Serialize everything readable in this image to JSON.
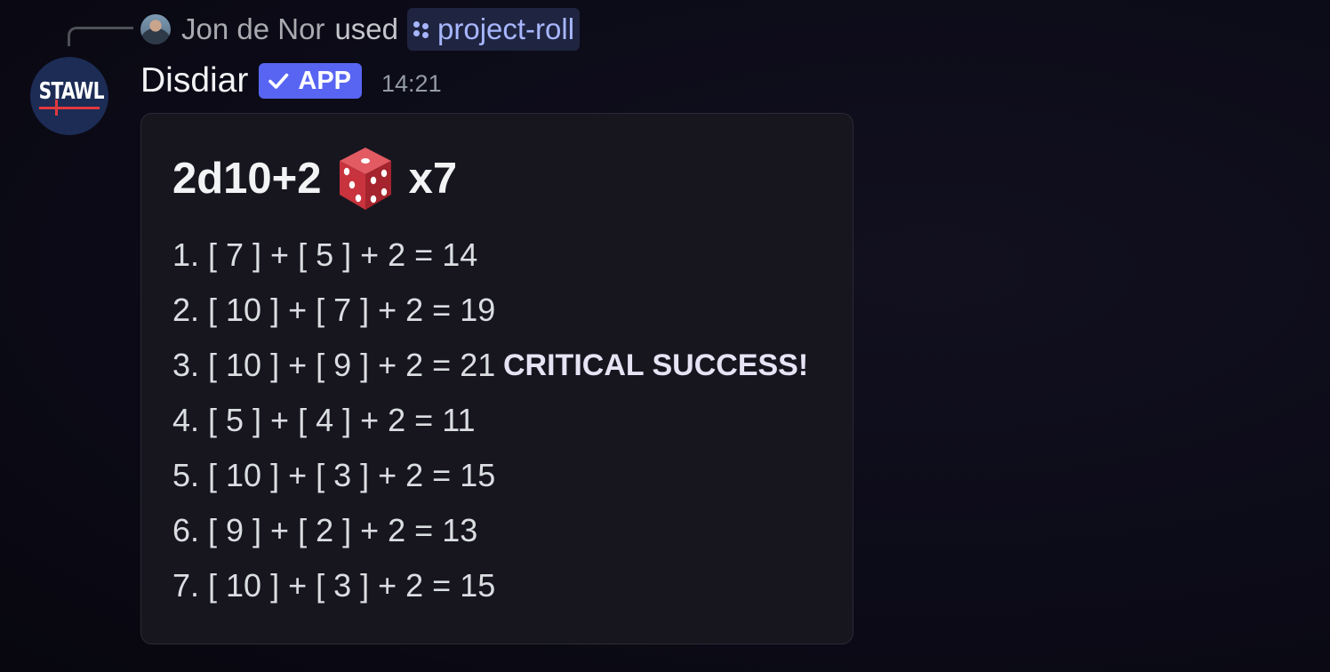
{
  "reply": {
    "user": "Jon de Nor",
    "verb": "used",
    "command": "project-roll"
  },
  "message": {
    "bot_name": "Disdiar",
    "app_tag": "APP",
    "timestamp": "14:21",
    "avatar_text": "STAWL"
  },
  "embed": {
    "title_left": "2d10+2",
    "title_icon": "game-die-icon",
    "title_right": "x7",
    "rolls": [
      {
        "text": "1. [ 7 ] + [ 5 ] + 2 = 14",
        "note": ""
      },
      {
        "text": "2. [ 10 ] + [ 7 ] + 2 = 19",
        "note": ""
      },
      {
        "text": "3. [ 10 ] + [ 9 ] + 2 = 21",
        "note": "CRITICAL SUCCESS!"
      },
      {
        "text": "4. [ 5 ] + [ 4 ] + 2 = 11",
        "note": ""
      },
      {
        "text": "5. [ 10 ] + [ 3 ] + 2 = 15",
        "note": ""
      },
      {
        "text": "6. [ 9 ] + [ 2 ] + 2 = 13",
        "note": ""
      },
      {
        "text": "7. [ 10 ] + [ 3 ] + 2 = 15",
        "note": ""
      }
    ]
  },
  "colors": {
    "accent": "#5865f2",
    "command_text": "#a7b6ff",
    "dice_red": "#c8333d",
    "background": "#0c0b18"
  }
}
